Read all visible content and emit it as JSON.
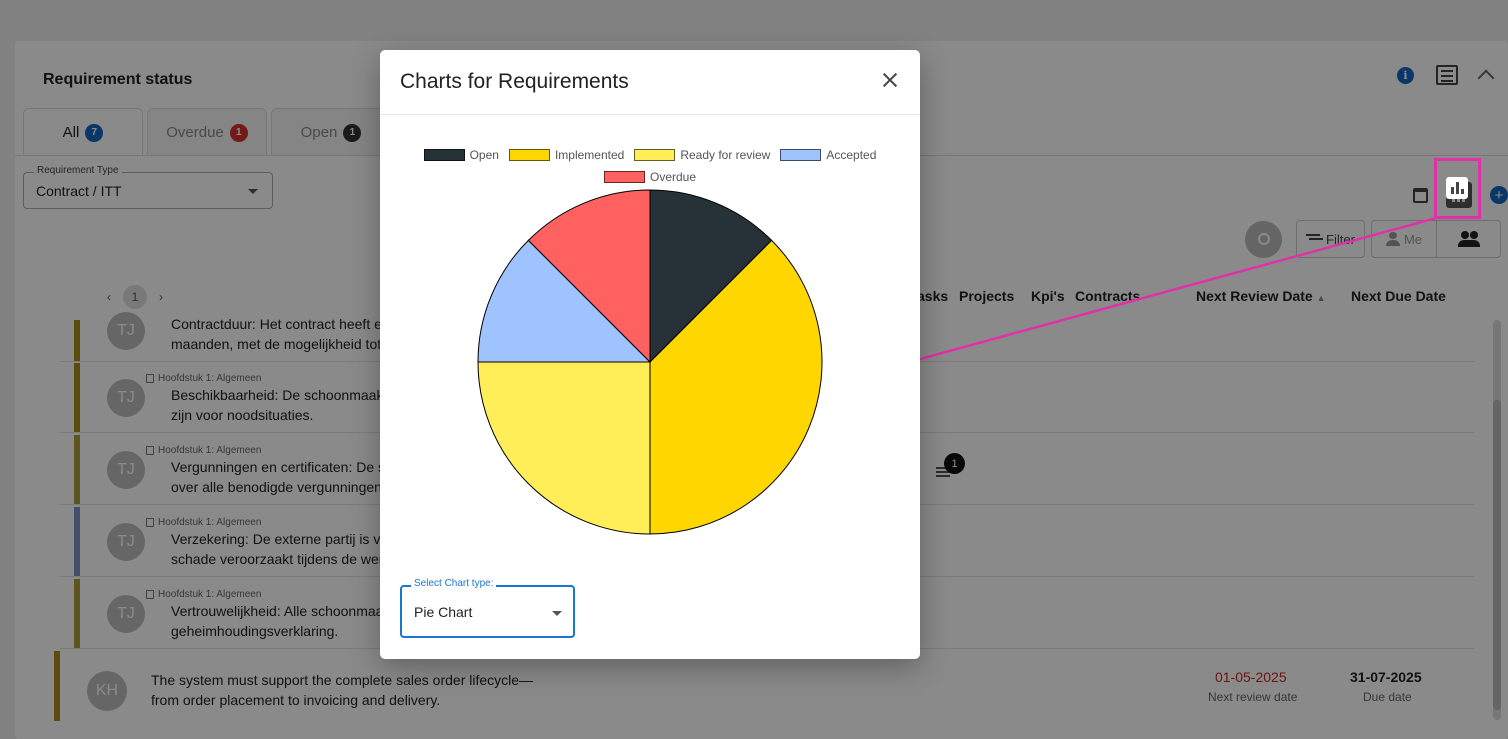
{
  "page": {
    "title": "Requirement status",
    "tabs": [
      {
        "label": "All",
        "count": "7",
        "color": "#1565c0"
      },
      {
        "label": "Overdue",
        "count": "1",
        "color": "#d32f2f"
      },
      {
        "label": "Open",
        "count": "1",
        "color": "#333333"
      }
    ],
    "requirement_type": {
      "label": "Requirement Type",
      "value": "Contract / ITT"
    },
    "filter_label": "Filter",
    "me_label": "Me",
    "pager_current": "1",
    "columns": [
      "asks",
      "Projects",
      "Kpi's",
      "Contracts",
      "Next Review Date",
      "Next Due Date"
    ],
    "rows": [
      {
        "initials": "TJ",
        "chapter": "",
        "line1": "Contractduur: Het contract heeft e",
        "line2": "maanden, met de mogelijkheid tot",
        "color": "#a88d1a"
      },
      {
        "initials": "TJ",
        "chapter": "Hoofdstuk 1: Algemeen",
        "line1": "Beschikbaarheid: De schoonmaak",
        "line2": "zijn voor noodsituaties.",
        "color": "#a88d1a"
      },
      {
        "initials": "TJ",
        "chapter": "Hoofdstuk 1: Algemeen",
        "line1": "Vergunningen en certificaten: De s",
        "line2": "over alle benodigde vergunningen",
        "color": "#b0a03a"
      },
      {
        "initials": "TJ",
        "chapter": "Hoofdstuk 1: Algemeen",
        "line1": "Verzekering: De externe partij is ve",
        "line2": "schade veroorzaakt tijdens de wer",
        "color": "#7f93c2"
      },
      {
        "initials": "TJ",
        "chapter": "Hoofdstuk 1: Algemeen",
        "line1": "Vertrouwelijkheid: Alle schoonmaa",
        "line2": "geheimhoudingsverklaring.",
        "color": "#b0a03a"
      }
    ],
    "task_badge": "1",
    "last_row": {
      "initials": "KH",
      "line1": "The system must support the complete sales order lifecycle—",
      "line2": "from order placement to invoicing and delivery.",
      "review_date": "01-05-2025",
      "review_label": "Next review date",
      "due_date": "31-07-2025",
      "due_label": "Due date"
    }
  },
  "modal": {
    "title": "Charts for Requirements",
    "select_label": "Select Chart type:",
    "select_value": "Pie Chart"
  },
  "chart_data": {
    "type": "pie",
    "categories": [
      "Open",
      "Implemented",
      "Ready for review",
      "Accepted",
      "Overdue"
    ],
    "values": [
      1,
      3,
      2,
      1,
      1
    ],
    "colors": [
      "#263238",
      "#ffd600",
      "#ffee58",
      "#9fc3ff",
      "#ff6161"
    ],
    "legend_position": "top"
  }
}
